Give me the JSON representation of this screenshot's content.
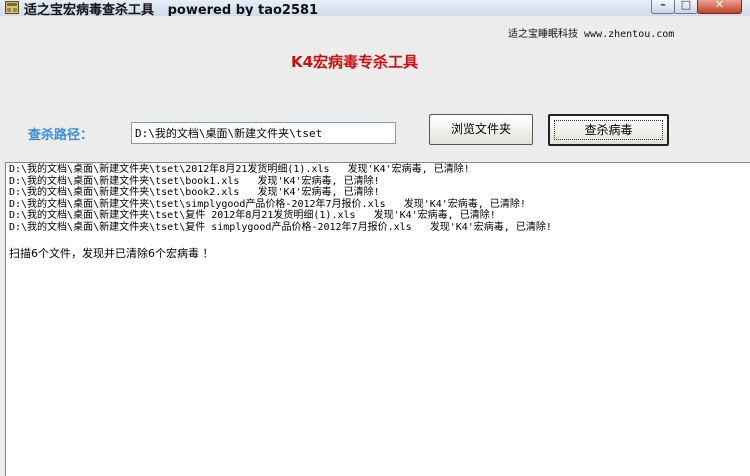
{
  "window": {
    "title": "适之宝宏病毒查杀工具   powered by tao2581",
    "buttons": {
      "minimize": "–",
      "maximize": "□",
      "close": "✕"
    }
  },
  "header": {
    "company": "适之宝睡眠科技 www.zhentou.com",
    "heading": "K4宏病毒专杀工具"
  },
  "form": {
    "path_label": "查杀路径：",
    "path_value": "D:\\我的文档\\桌面\\新建文件夹\\tset",
    "browse_label": "浏览文件夹",
    "scan_label": "查杀病毒"
  },
  "log": {
    "lines": [
      "D:\\我的文档\\桌面\\新建文件夹\\tset\\2012年8月21发货明细(1).xls   发现'K4'宏病毒, 已清除!",
      "D:\\我的文档\\桌面\\新建文件夹\\tset\\book1.xls   发现'K4'宏病毒, 已清除!",
      "D:\\我的文档\\桌面\\新建文件夹\\tset\\book2.xls   发现'K4'宏病毒, 已清除!",
      "D:\\我的文档\\桌面\\新建文件夹\\tset\\simplygood产品价格-2012年7月报价.xls   发现'K4'宏病毒, 已清除!",
      "D:\\我的文档\\桌面\\新建文件夹\\tset\\复件 2012年8月21发货明细(1).xls   发现'K4'宏病毒, 已清除!",
      "D:\\我的文档\\桌面\\新建文件夹\\tset\\复件 simplygood产品价格-2012年7月报价.xls   发现'K4'宏病毒, 已清除!"
    ],
    "summary": "扫描6个文件，发现并已清除6个宏病毒 ！"
  }
}
